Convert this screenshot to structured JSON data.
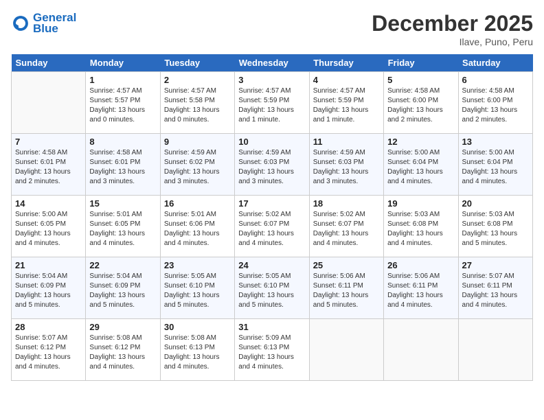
{
  "header": {
    "logo_line1": "General",
    "logo_line2": "Blue",
    "month": "December 2025",
    "location": "Ilave, Puno, Peru"
  },
  "weekdays": [
    "Sunday",
    "Monday",
    "Tuesday",
    "Wednesday",
    "Thursday",
    "Friday",
    "Saturday"
  ],
  "weeks": [
    [
      {
        "day": "",
        "sunrise": "",
        "sunset": "",
        "daylight": ""
      },
      {
        "day": "1",
        "sunrise": "Sunrise: 4:57 AM",
        "sunset": "Sunset: 5:57 PM",
        "daylight": "Daylight: 13 hours and 0 minutes."
      },
      {
        "day": "2",
        "sunrise": "Sunrise: 4:57 AM",
        "sunset": "Sunset: 5:58 PM",
        "daylight": "Daylight: 13 hours and 0 minutes."
      },
      {
        "day": "3",
        "sunrise": "Sunrise: 4:57 AM",
        "sunset": "Sunset: 5:59 PM",
        "daylight": "Daylight: 13 hours and 1 minute."
      },
      {
        "day": "4",
        "sunrise": "Sunrise: 4:57 AM",
        "sunset": "Sunset: 5:59 PM",
        "daylight": "Daylight: 13 hours and 1 minute."
      },
      {
        "day": "5",
        "sunrise": "Sunrise: 4:58 AM",
        "sunset": "Sunset: 6:00 PM",
        "daylight": "Daylight: 13 hours and 2 minutes."
      },
      {
        "day": "6",
        "sunrise": "Sunrise: 4:58 AM",
        "sunset": "Sunset: 6:00 PM",
        "daylight": "Daylight: 13 hours and 2 minutes."
      }
    ],
    [
      {
        "day": "7",
        "sunrise": "Sunrise: 4:58 AM",
        "sunset": "Sunset: 6:01 PM",
        "daylight": "Daylight: 13 hours and 2 minutes."
      },
      {
        "day": "8",
        "sunrise": "Sunrise: 4:58 AM",
        "sunset": "Sunset: 6:01 PM",
        "daylight": "Daylight: 13 hours and 3 minutes."
      },
      {
        "day": "9",
        "sunrise": "Sunrise: 4:59 AM",
        "sunset": "Sunset: 6:02 PM",
        "daylight": "Daylight: 13 hours and 3 minutes."
      },
      {
        "day": "10",
        "sunrise": "Sunrise: 4:59 AM",
        "sunset": "Sunset: 6:03 PM",
        "daylight": "Daylight: 13 hours and 3 minutes."
      },
      {
        "day": "11",
        "sunrise": "Sunrise: 4:59 AM",
        "sunset": "Sunset: 6:03 PM",
        "daylight": "Daylight: 13 hours and 3 minutes."
      },
      {
        "day": "12",
        "sunrise": "Sunrise: 5:00 AM",
        "sunset": "Sunset: 6:04 PM",
        "daylight": "Daylight: 13 hours and 4 minutes."
      },
      {
        "day": "13",
        "sunrise": "Sunrise: 5:00 AM",
        "sunset": "Sunset: 6:04 PM",
        "daylight": "Daylight: 13 hours and 4 minutes."
      }
    ],
    [
      {
        "day": "14",
        "sunrise": "Sunrise: 5:00 AM",
        "sunset": "Sunset: 6:05 PM",
        "daylight": "Daylight: 13 hours and 4 minutes."
      },
      {
        "day": "15",
        "sunrise": "Sunrise: 5:01 AM",
        "sunset": "Sunset: 6:05 PM",
        "daylight": "Daylight: 13 hours and 4 minutes."
      },
      {
        "day": "16",
        "sunrise": "Sunrise: 5:01 AM",
        "sunset": "Sunset: 6:06 PM",
        "daylight": "Daylight: 13 hours and 4 minutes."
      },
      {
        "day": "17",
        "sunrise": "Sunrise: 5:02 AM",
        "sunset": "Sunset: 6:07 PM",
        "daylight": "Daylight: 13 hours and 4 minutes."
      },
      {
        "day": "18",
        "sunrise": "Sunrise: 5:02 AM",
        "sunset": "Sunset: 6:07 PM",
        "daylight": "Daylight: 13 hours and 4 minutes."
      },
      {
        "day": "19",
        "sunrise": "Sunrise: 5:03 AM",
        "sunset": "Sunset: 6:08 PM",
        "daylight": "Daylight: 13 hours and 4 minutes."
      },
      {
        "day": "20",
        "sunrise": "Sunrise: 5:03 AM",
        "sunset": "Sunset: 6:08 PM",
        "daylight": "Daylight: 13 hours and 5 minutes."
      }
    ],
    [
      {
        "day": "21",
        "sunrise": "Sunrise: 5:04 AM",
        "sunset": "Sunset: 6:09 PM",
        "daylight": "Daylight: 13 hours and 5 minutes."
      },
      {
        "day": "22",
        "sunrise": "Sunrise: 5:04 AM",
        "sunset": "Sunset: 6:09 PM",
        "daylight": "Daylight: 13 hours and 5 minutes."
      },
      {
        "day": "23",
        "sunrise": "Sunrise: 5:05 AM",
        "sunset": "Sunset: 6:10 PM",
        "daylight": "Daylight: 13 hours and 5 minutes."
      },
      {
        "day": "24",
        "sunrise": "Sunrise: 5:05 AM",
        "sunset": "Sunset: 6:10 PM",
        "daylight": "Daylight: 13 hours and 5 minutes."
      },
      {
        "day": "25",
        "sunrise": "Sunrise: 5:06 AM",
        "sunset": "Sunset: 6:11 PM",
        "daylight": "Daylight: 13 hours and 5 minutes."
      },
      {
        "day": "26",
        "sunrise": "Sunrise: 5:06 AM",
        "sunset": "Sunset: 6:11 PM",
        "daylight": "Daylight: 13 hours and 4 minutes."
      },
      {
        "day": "27",
        "sunrise": "Sunrise: 5:07 AM",
        "sunset": "Sunset: 6:11 PM",
        "daylight": "Daylight: 13 hours and 4 minutes."
      }
    ],
    [
      {
        "day": "28",
        "sunrise": "Sunrise: 5:07 AM",
        "sunset": "Sunset: 6:12 PM",
        "daylight": "Daylight: 13 hours and 4 minutes."
      },
      {
        "day": "29",
        "sunrise": "Sunrise: 5:08 AM",
        "sunset": "Sunset: 6:12 PM",
        "daylight": "Daylight: 13 hours and 4 minutes."
      },
      {
        "day": "30",
        "sunrise": "Sunrise: 5:08 AM",
        "sunset": "Sunset: 6:13 PM",
        "daylight": "Daylight: 13 hours and 4 minutes."
      },
      {
        "day": "31",
        "sunrise": "Sunrise: 5:09 AM",
        "sunset": "Sunset: 6:13 PM",
        "daylight": "Daylight: 13 hours and 4 minutes."
      },
      {
        "day": "",
        "sunrise": "",
        "sunset": "",
        "daylight": ""
      },
      {
        "day": "",
        "sunrise": "",
        "sunset": "",
        "daylight": ""
      },
      {
        "day": "",
        "sunrise": "",
        "sunset": "",
        "daylight": ""
      }
    ]
  ]
}
